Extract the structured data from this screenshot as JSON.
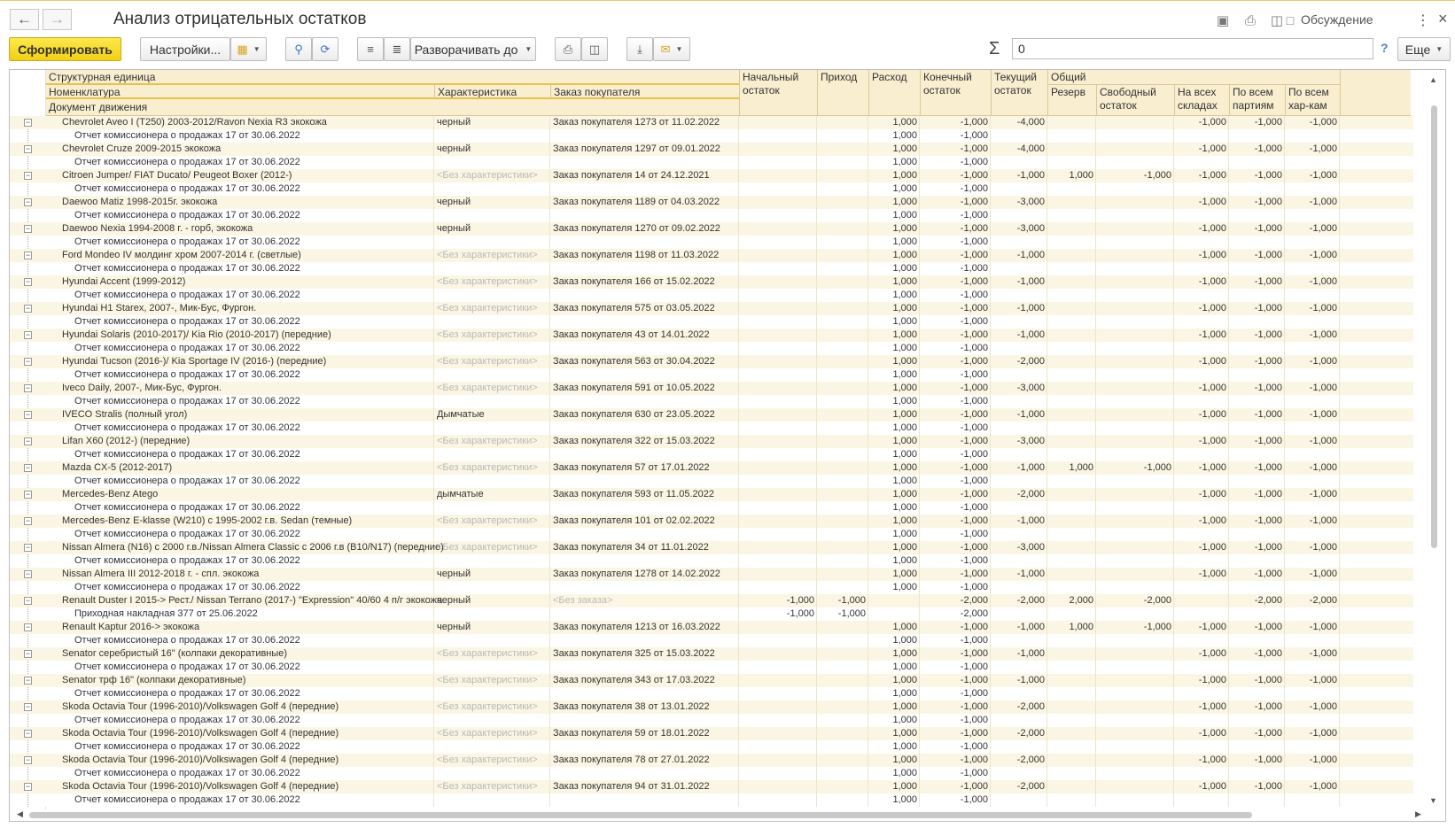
{
  "window": {
    "title": "Анализ отрицательных остатков",
    "discuss_label": "Обсуждение"
  },
  "toolbar": {
    "generate_label": "Сформировать",
    "settings_label": "Настройки...",
    "expand_label": "Разворачивать до",
    "sum_value": "0",
    "help_label": "?",
    "more_label": "Еще"
  },
  "header": {
    "struct_unit": "Структурная единица",
    "nomenclature": "Номенклатура",
    "characteristic": "Характеристика",
    "order": "Заказ покупателя",
    "movement_doc": "Документ движения",
    "opening": "Начальный остаток",
    "income": "Приход",
    "expense": "Расход",
    "closing": "Конечный остаток",
    "current": "Текущий остаток",
    "general": "Общий",
    "reserve": "Резерв",
    "free": "Свободный остаток",
    "all_wh": "На всех складах",
    "all_batches": "По всем партиям",
    "all_chars": "По всем хар-кам"
  },
  "rows": [
    {
      "name": "Chevrolet Aveo I (T250) 2003-2012/Ravon Nexia R3 экокожа",
      "char": "черный",
      "order": "Заказ покупателя 1273 от 11.02.2022",
      "open": "",
      "inc": "",
      "exp": "1,000",
      "close": "-1,000",
      "cur": "-4,000",
      "res": "",
      "free": "",
      "wh": "-1,000",
      "bat": "-1,000",
      "chr": "-1,000",
      "doc": "Отчет комиссионера о продажах 17 от 30.06.2022",
      "d_open": "",
      "d_inc": "",
      "d_exp": "1,000",
      "d_close": "-1,000"
    },
    {
      "name": "Chevrolet Cruze 2009-2015 экокожа",
      "char": "черный",
      "order": "Заказ покупателя 1297 от 09.01.2022",
      "open": "",
      "inc": "",
      "exp": "1,000",
      "close": "-1,000",
      "cur": "-4,000",
      "res": "",
      "free": "",
      "wh": "-1,000",
      "bat": "-1,000",
      "chr": "-1,000",
      "doc": "Отчет комиссионера о продажах 17 от 30.06.2022",
      "d_open": "",
      "d_inc": "",
      "d_exp": "1,000",
      "d_close": "-1,000"
    },
    {
      "name": "Citroen Jumper/ FIAT Ducato/ Peugeot Boxer (2012-)",
      "char": "<Без характеристики>",
      "gray": true,
      "order": "Заказ покупателя 14 от 24.12.2021",
      "open": "",
      "inc": "",
      "exp": "1,000",
      "close": "-1,000",
      "cur": "-1,000",
      "res": "1,000",
      "free": "-1,000",
      "wh": "-1,000",
      "bat": "-1,000",
      "chr": "-1,000",
      "doc": "Отчет комиссионера о продажах 17 от 30.06.2022",
      "d_open": "",
      "d_inc": "",
      "d_exp": "1,000",
      "d_close": "-1,000"
    },
    {
      "name": "Daewoo Matiz 1998-2015г. экокожа",
      "char": "черный",
      "order": "Заказ покупателя 1189 от 04.03.2022",
      "open": "",
      "inc": "",
      "exp": "1,000",
      "close": "-1,000",
      "cur": "-3,000",
      "res": "",
      "free": "",
      "wh": "-1,000",
      "bat": "-1,000",
      "chr": "-1,000",
      "doc": "Отчет комиссионера о продажах 17 от 30.06.2022",
      "d_open": "",
      "d_inc": "",
      "d_exp": "1,000",
      "d_close": "-1,000"
    },
    {
      "name": "Daewoo Nexia 1994-2008 г. - горб, экокожа",
      "char": "черный",
      "order": "Заказ покупателя 1270 от 09.02.2022",
      "open": "",
      "inc": "",
      "exp": "1,000",
      "close": "-1,000",
      "cur": "-3,000",
      "res": "",
      "free": "",
      "wh": "-1,000",
      "bat": "-1,000",
      "chr": "-1,000",
      "doc": "Отчет комиссионера о продажах 17 от 30.06.2022",
      "d_open": "",
      "d_inc": "",
      "d_exp": "1,000",
      "d_close": "-1,000"
    },
    {
      "name": "Ford Mondeo IV молдинг хром 2007-2014 г. (светлые)",
      "char": "<Без характеристики>",
      "gray": true,
      "order": "Заказ покупателя 1198 от 11.03.2022",
      "open": "",
      "inc": "",
      "exp": "1,000",
      "close": "-1,000",
      "cur": "-1,000",
      "res": "",
      "free": "",
      "wh": "-1,000",
      "bat": "-1,000",
      "chr": "-1,000",
      "doc": "Отчет комиссионера о продажах 17 от 30.06.2022",
      "d_open": "",
      "d_inc": "",
      "d_exp": "1,000",
      "d_close": "-1,000"
    },
    {
      "name": "Hyundai Accent (1999-2012)",
      "char": "<Без характеристики>",
      "gray": true,
      "order": "Заказ покупателя 166 от 15.02.2022",
      "open": "",
      "inc": "",
      "exp": "1,000",
      "close": "-1,000",
      "cur": "-1,000",
      "res": "",
      "free": "",
      "wh": "-1,000",
      "bat": "-1,000",
      "chr": "-1,000",
      "doc": "Отчет комиссионера о продажах 17 от 30.06.2022",
      "d_open": "",
      "d_inc": "",
      "d_exp": "1,000",
      "d_close": "-1,000"
    },
    {
      "name": "Hyundai H1 Starex, 2007-, Мик-Бус, Фургон.",
      "char": "<Без характеристики>",
      "gray": true,
      "order": "Заказ покупателя 575 от 03.05.2022",
      "open": "",
      "inc": "",
      "exp": "1,000",
      "close": "-1,000",
      "cur": "-1,000",
      "res": "",
      "free": "",
      "wh": "-1,000",
      "bat": "-1,000",
      "chr": "-1,000",
      "doc": "Отчет комиссионера о продажах 17 от 30.06.2022",
      "d_open": "",
      "d_inc": "",
      "d_exp": "1,000",
      "d_close": "-1,000"
    },
    {
      "name": "Hyundai Solaris (2010-2017)/ Kia Rio (2010-2017) (передние)",
      "char": "<Без характеристики>",
      "gray": true,
      "order": "Заказ покупателя 43 от 14.01.2022",
      "open": "",
      "inc": "",
      "exp": "1,000",
      "close": "-1,000",
      "cur": "-1,000",
      "res": "",
      "free": "",
      "wh": "-1,000",
      "bat": "-1,000",
      "chr": "-1,000",
      "doc": "Отчет комиссионера о продажах 17 от 30.06.2022",
      "d_open": "",
      "d_inc": "",
      "d_exp": "1,000",
      "d_close": "-1,000"
    },
    {
      "name": "Hyundai Tucson (2016-)/ Kia Sportage IV (2016-) (передние)",
      "char": "<Без характеристики>",
      "gray": true,
      "order": "Заказ покупателя 563 от 30.04.2022",
      "open": "",
      "inc": "",
      "exp": "1,000",
      "close": "-1,000",
      "cur": "-2,000",
      "res": "",
      "free": "",
      "wh": "-1,000",
      "bat": "-1,000",
      "chr": "-1,000",
      "doc": "Отчет комиссионера о продажах 17 от 30.06.2022",
      "d_open": "",
      "d_inc": "",
      "d_exp": "1,000",
      "d_close": "-1,000"
    },
    {
      "name": "Iveco Daily, 2007-, Мик-Бус, Фургон.",
      "char": "<Без характеристики>",
      "gray": true,
      "order": "Заказ покупателя 591 от 10.05.2022",
      "open": "",
      "inc": "",
      "exp": "1,000",
      "close": "-1,000",
      "cur": "-3,000",
      "res": "",
      "free": "",
      "wh": "-1,000",
      "bat": "-1,000",
      "chr": "-1,000",
      "doc": "Отчет комиссионера о продажах 17 от 30.06.2022",
      "d_open": "",
      "d_inc": "",
      "d_exp": "1,000",
      "d_close": "-1,000"
    },
    {
      "name": "IVECO Stralis (полный угол)",
      "char": "Дымчатые",
      "order": "Заказ покупателя 630 от 23.05.2022",
      "open": "",
      "inc": "",
      "exp": "1,000",
      "close": "-1,000",
      "cur": "-1,000",
      "res": "",
      "free": "",
      "wh": "-1,000",
      "bat": "-1,000",
      "chr": "-1,000",
      "doc": "Отчет комиссионера о продажах 17 от 30.06.2022",
      "d_open": "",
      "d_inc": "",
      "d_exp": "1,000",
      "d_close": "-1,000"
    },
    {
      "name": "Lifan X60 (2012-) (передние)",
      "char": "<Без характеристики>",
      "gray": true,
      "order": "Заказ покупателя 322 от 15.03.2022",
      "open": "",
      "inc": "",
      "exp": "1,000",
      "close": "-1,000",
      "cur": "-3,000",
      "res": "",
      "free": "",
      "wh": "-1,000",
      "bat": "-1,000",
      "chr": "-1,000",
      "doc": "Отчет комиссионера о продажах 17 от 30.06.2022",
      "d_open": "",
      "d_inc": "",
      "d_exp": "1,000",
      "d_close": "-1,000"
    },
    {
      "name": "Mazda CX-5 (2012-2017)",
      "char": "<Без характеристики>",
      "gray": true,
      "order": "Заказ покупателя 57 от 17.01.2022",
      "open": "",
      "inc": "",
      "exp": "1,000",
      "close": "-1,000",
      "cur": "-1,000",
      "res": "1,000",
      "free": "-1,000",
      "wh": "-1,000",
      "bat": "-1,000",
      "chr": "-1,000",
      "doc": "Отчет комиссионера о продажах 17 от 30.06.2022",
      "d_open": "",
      "d_inc": "",
      "d_exp": "1,000",
      "d_close": "-1,000"
    },
    {
      "name": "Mercedes-Benz Atego",
      "char": "дымчатые",
      "order": "Заказ покупателя 593 от 11.05.2022",
      "open": "",
      "inc": "",
      "exp": "1,000",
      "close": "-1,000",
      "cur": "-2,000",
      "res": "",
      "free": "",
      "wh": "-1,000",
      "bat": "-1,000",
      "chr": "-1,000",
      "doc": "Отчет комиссионера о продажах 17 от 30.06.2022",
      "d_open": "",
      "d_inc": "",
      "d_exp": "1,000",
      "d_close": "-1,000"
    },
    {
      "name": "Mercedes-Benz E-klasse (W210) с 1995-2002 г.в. Sedan (темные)",
      "char": "<Без характеристики>",
      "gray": true,
      "order": "Заказ покупателя 101 от 02.02.2022",
      "open": "",
      "inc": "",
      "exp": "1,000",
      "close": "-1,000",
      "cur": "-1,000",
      "res": "",
      "free": "",
      "wh": "-1,000",
      "bat": "-1,000",
      "chr": "-1,000",
      "doc": "Отчет комиссионера о продажах 17 от 30.06.2022",
      "d_open": "",
      "d_inc": "",
      "d_exp": "1,000",
      "d_close": "-1,000"
    },
    {
      "name": "Nissan Almera (N16) с 2000 г.в./Nissan Almera Classic с 2006 г.в (B10/N17) (передние)",
      "char": "<Без характеристики>",
      "gray": true,
      "order": "Заказ покупателя 34 от 11.01.2022",
      "open": "",
      "inc": "",
      "exp": "1,000",
      "close": "-1,000",
      "cur": "-3,000",
      "res": "",
      "free": "",
      "wh": "-1,000",
      "bat": "-1,000",
      "chr": "-1,000",
      "doc": "Отчет комиссионера о продажах 17 от 30.06.2022",
      "d_open": "",
      "d_inc": "",
      "d_exp": "1,000",
      "d_close": "-1,000"
    },
    {
      "name": "Nissan Almera III 2012-2018 г. - спл. экокожа",
      "char": "черный",
      "order": "Заказ покупателя 1278 от 14.02.2022",
      "open": "",
      "inc": "",
      "exp": "1,000",
      "close": "-1,000",
      "cur": "-1,000",
      "res": "",
      "free": "",
      "wh": "-1,000",
      "bat": "-1,000",
      "chr": "-1,000",
      "doc": "Отчет комиссионера о продажах 17 от 30.06.2022",
      "d_open": "",
      "d_inc": "",
      "d_exp": "1,000",
      "d_close": "-1,000"
    },
    {
      "name": "Renault Duster I 2015-> Рест./ Nissan Terrano (2017-) \"Expression\" 40/60 4 п/г экокожа",
      "char": "черный",
      "order": "<Без заказа>",
      "ordergray": true,
      "open": "-1,000",
      "inc": "-1,000",
      "exp": "",
      "close": "-2,000",
      "cur": "-2,000",
      "res": "2,000",
      "free": "-2,000",
      "wh": "",
      "bat": "-2,000",
      "chr": "-2,000",
      "doc": "Приходная накладная 377 от 25.06.2022",
      "d_open": "-1,000",
      "d_inc": "-1,000",
      "d_exp": "",
      "d_close": "-2,000"
    },
    {
      "name": "Renault Kaptur 2016-> экокожа",
      "char": "черный",
      "order": "Заказ покупателя 1213 от 16.03.2022",
      "open": "",
      "inc": "",
      "exp": "1,000",
      "close": "-1,000",
      "cur": "-1,000",
      "res": "1,000",
      "free": "-1,000",
      "wh": "-1,000",
      "bat": "-1,000",
      "chr": "-1,000",
      "doc": "Отчет комиссионера о продажах 17 от 30.06.2022",
      "d_open": "",
      "d_inc": "",
      "d_exp": "1,000",
      "d_close": "-1,000"
    },
    {
      "name": "Senator серебристый 16\" (колпаки декоративные)",
      "char": "<Без характеристики>",
      "gray": true,
      "order": "Заказ покупателя 325 от 15.03.2022",
      "open": "",
      "inc": "",
      "exp": "1,000",
      "close": "-1,000",
      "cur": "-1,000",
      "res": "",
      "free": "",
      "wh": "-1,000",
      "bat": "-1,000",
      "chr": "-1,000",
      "doc": "Отчет комиссионера о продажах 17 от 30.06.2022",
      "d_open": "",
      "d_inc": "",
      "d_exp": "1,000",
      "d_close": "-1,000"
    },
    {
      "name": "Senator трф 16\" (колпаки декоративные)",
      "char": "<Без характеристики>",
      "gray": true,
      "order": "Заказ покупателя 343 от 17.03.2022",
      "open": "",
      "inc": "",
      "exp": "1,000",
      "close": "-1,000",
      "cur": "-1,000",
      "res": "",
      "free": "",
      "wh": "-1,000",
      "bat": "-1,000",
      "chr": "-1,000",
      "doc": "Отчет комиссионера о продажах 17 от 30.06.2022",
      "d_open": "",
      "d_inc": "",
      "d_exp": "1,000",
      "d_close": "-1,000"
    },
    {
      "name": "Skoda Octavia Tour (1996-2010)/Volkswagen Golf 4 (передние)",
      "char": "<Без характеристики>",
      "gray": true,
      "order": "Заказ покупателя 38 от 13.01.2022",
      "open": "",
      "inc": "",
      "exp": "1,000",
      "close": "-1,000",
      "cur": "-2,000",
      "res": "",
      "free": "",
      "wh": "-1,000",
      "bat": "-1,000",
      "chr": "-1,000",
      "doc": "Отчет комиссионера о продажах 17 от 30.06.2022",
      "d_open": "",
      "d_inc": "",
      "d_exp": "1,000",
      "d_close": "-1,000"
    },
    {
      "name": "Skoda Octavia Tour (1996-2010)/Volkswagen Golf 4 (передние)",
      "char": "<Без характеристики>",
      "gray": true,
      "order": "Заказ покупателя 59 от 18.01.2022",
      "open": "",
      "inc": "",
      "exp": "1,000",
      "close": "-1,000",
      "cur": "-2,000",
      "res": "",
      "free": "",
      "wh": "-1,000",
      "bat": "-1,000",
      "chr": "-1,000",
      "doc": "Отчет комиссионера о продажах 17 от 30.06.2022",
      "d_open": "",
      "d_inc": "",
      "d_exp": "1,000",
      "d_close": "-1,000"
    },
    {
      "name": "Skoda Octavia Tour (1996-2010)/Volkswagen Golf 4 (передние)",
      "char": "<Без характеристики>",
      "gray": true,
      "order": "Заказ покупателя 78 от 27.01.2022",
      "open": "",
      "inc": "",
      "exp": "1,000",
      "close": "-1,000",
      "cur": "-2,000",
      "res": "",
      "free": "",
      "wh": "-1,000",
      "bat": "-1,000",
      "chr": "-1,000",
      "doc": "Отчет комиссионера о продажах 17 от 30.06.2022",
      "d_open": "",
      "d_inc": "",
      "d_exp": "1,000",
      "d_close": "-1,000"
    },
    {
      "name": "Skoda Octavia Tour (1996-2010)/Volkswagen Golf 4 (передние)",
      "char": "<Без характеристики>",
      "gray": true,
      "order": "Заказ покупателя 94 от 31.01.2022",
      "open": "",
      "inc": "",
      "exp": "1,000",
      "close": "-1,000",
      "cur": "-2,000",
      "res": "",
      "free": "",
      "wh": "-1,000",
      "bat": "-1,000",
      "chr": "-1,000",
      "doc": "Отчет комиссионера о продажах 17 от 30.06.2022",
      "d_open": "",
      "d_inc": "",
      "d_exp": "1,000",
      "d_close": "-1,000"
    }
  ]
}
